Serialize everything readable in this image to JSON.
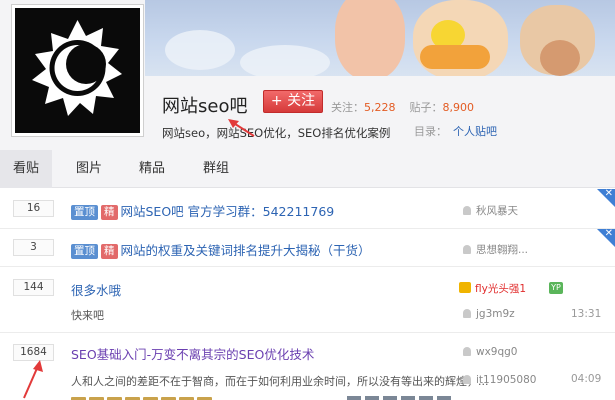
{
  "forum": {
    "name": "网站seo吧",
    "follow_label": "+ 关注",
    "follow_count_label": "关注：",
    "follow_count": "5,228",
    "post_count_label": "贴子：",
    "post_count": "8,900",
    "description": "网站seo，网站SEO优化，SEO排名优化案例",
    "directory_label": "目录：",
    "directory_value": "个人贴吧"
  },
  "tabs": [
    {
      "label": "看贴"
    },
    {
      "label": "图片"
    },
    {
      "label": "精品"
    },
    {
      "label": "群组"
    }
  ],
  "threads": [
    {
      "replies": "16",
      "tag_top": "置顶",
      "tag_good": "精",
      "title": "网站SEO吧 官方学习群：542211769",
      "author": "秋风暴天"
    },
    {
      "replies": "3",
      "tag_top": "置顶",
      "tag_good": "精",
      "title": "网站的权重及关键词排名提升大揭秘（干货）",
      "author": "思想翱翔..."
    },
    {
      "replies": "144",
      "title": "很多水哦",
      "abstract": "快来吧",
      "author": "fly光头强1",
      "last_replier": "jg3m9z",
      "badge": "YP",
      "time": "13:31"
    },
    {
      "replies": "1684",
      "title": "SEO基础入门-万变不离其宗的SEO优化技术",
      "abstract": "人和人之间的差距不在于智商，而在于如何利用业余时间，所以没有等出来的辉煌，...",
      "author": "wx9qg0",
      "last_replier": "it11905080",
      "time": "04:09"
    }
  ],
  "icons": {
    "logo": "sun-moon-logo",
    "corner": "close-corner-icon",
    "user": "user-icon",
    "vip": "vip-crown-icon"
  },
  "colors": {
    "accent_red": "#e23a3a",
    "link_blue": "#2d64b3",
    "tag_blue": "#5a8fd1",
    "tag_red": "#e26a6a",
    "count_orange": "#e35c24",
    "corner_blue": "#3f7fd4"
  }
}
